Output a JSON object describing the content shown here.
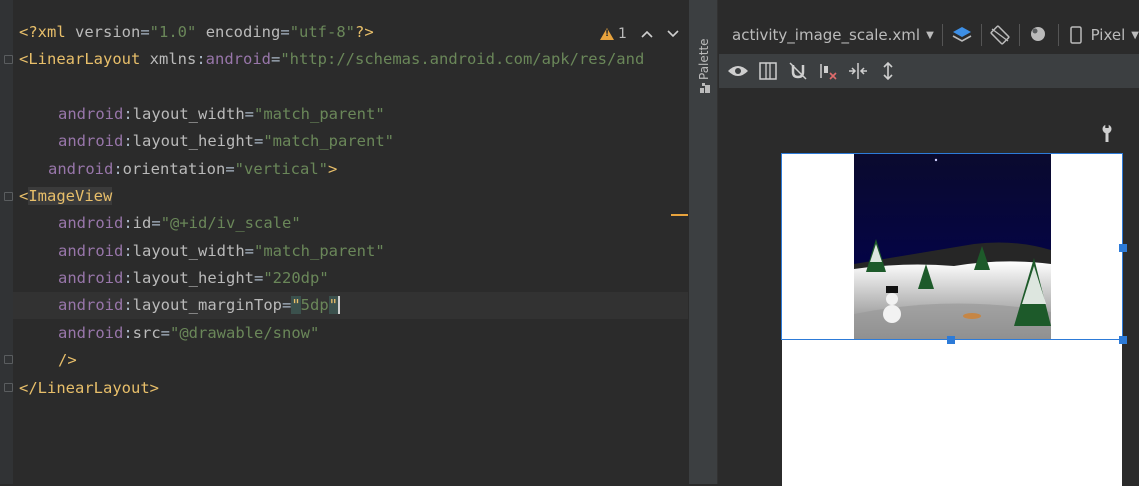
{
  "editor": {
    "lines": [
      {
        "xml_decl_open": "<?xml ",
        "version_attr": "version",
        "version_val": "\"1.0\"",
        "enc_attr": "encoding",
        "enc_val": "\"utf-8\"",
        "close": "?>"
      },
      {
        "tag_open": "<LinearLayout ",
        "ns_attr": "xmlns",
        "ns_prefix": "android",
        "ns_val": "\"http://schemas.android.com/apk/res/and"
      },
      {
        "ns": "android",
        "attr": "layout_width",
        "val": "\"match_parent\""
      },
      {
        "ns": "android",
        "attr": "layout_height",
        "val": "\"match_parent\""
      },
      {
        "ns": "android",
        "attr": "orientation",
        "val": "\"vertical\"",
        "close": ">"
      },
      {
        "tag_open": "<",
        "tag_name": "ImageView"
      },
      {
        "ns": "android",
        "attr": "id",
        "val": "\"@+id/iv_scale\""
      },
      {
        "ns": "android",
        "attr": "layout_width",
        "val": "\"match_parent\""
      },
      {
        "ns": "android",
        "attr": "layout_height",
        "val": "\"220dp\""
      },
      {
        "ns": "android",
        "attr": "layout_marginTop",
        "val_open": "\"",
        "val_body": "5dp",
        "val_close": "\""
      },
      {
        "ns": "android",
        "attr": "src",
        "val": "\"@drawable/snow\""
      },
      {
        "self_close": "/>"
      },
      {
        "close_tag": "</LinearLayout>"
      }
    ],
    "warnings": {
      "count": "1",
      "up": "^",
      "down": "v"
    }
  },
  "palette": {
    "label": "Palette"
  },
  "design": {
    "file_name": "activity_image_scale.xml",
    "device": "Pixel"
  },
  "colors": {
    "accent": "#2d7bd8",
    "warning": "#e8a33d",
    "tag": "#e8bf6a",
    "attr_ns": "#9876aa",
    "string": "#6a8759"
  },
  "icons": [
    "warning-icon",
    "chevron-up-icon",
    "chevron-down-icon",
    "layers-icon",
    "rotate-icon",
    "theme-icon",
    "phone-icon",
    "eye-icon",
    "blueprint-icon",
    "magnet-off-icon",
    "clear-constraints-icon",
    "pack-horizontal-icon",
    "pack-vertical-icon",
    "wrench-icon",
    "palette-icon"
  ]
}
